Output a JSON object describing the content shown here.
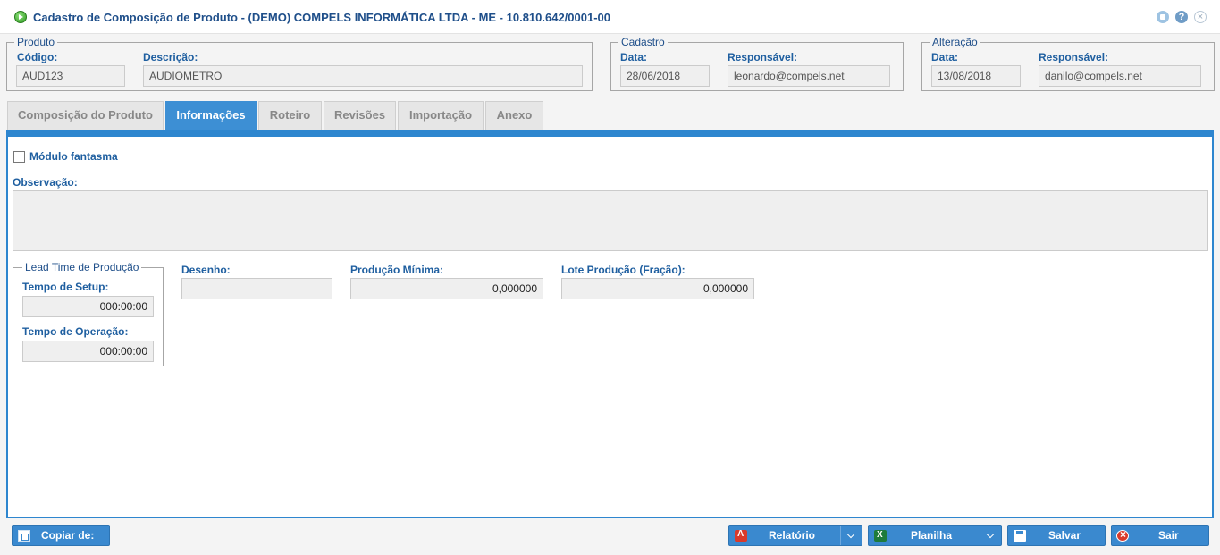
{
  "window": {
    "title": "Cadastro de Composição de Produto - (DEMO) COMPELS INFORMÁTICA LTDA - ME - 10.810.642/0001-00",
    "help_glyph": "?",
    "close_glyph": "×"
  },
  "produto": {
    "legend": "Produto",
    "codigo_label": "Código:",
    "codigo_value": "AUD123",
    "descricao_label": "Descrição:",
    "descricao_value": "AUDIOMETRO"
  },
  "cadastro": {
    "legend": "Cadastro",
    "data_label": "Data:",
    "data_value": "28/06/2018",
    "responsavel_label": "Responsável:",
    "responsavel_value": "leonardo@compels.net"
  },
  "alteracao": {
    "legend": "Alteração",
    "data_label": "Data:",
    "data_value": "13/08/2018",
    "responsavel_label": "Responsável:",
    "responsavel_value": "danilo@compels.net"
  },
  "tabs": [
    {
      "label": "Composição do Produto",
      "active": false
    },
    {
      "label": "Informações",
      "active": true
    },
    {
      "label": "Roteiro",
      "active": false
    },
    {
      "label": "Revisões",
      "active": false
    },
    {
      "label": "Importação",
      "active": false
    },
    {
      "label": "Anexo",
      "active": false
    }
  ],
  "informacoes": {
    "modulo_fantasma_label": "Módulo fantasma",
    "modulo_fantasma_checked": false,
    "observacao_label": "Observação:",
    "observacao_value": "",
    "lead_time": {
      "legend": "Lead Time de Produção",
      "setup_label": "Tempo de Setup:",
      "setup_value": "000:00:00",
      "operacao_label": "Tempo de Operação:",
      "operacao_value": "000:00:00"
    },
    "desenho_label": "Desenho:",
    "desenho_value": "",
    "producao_minima_label": "Produção Mínima:",
    "producao_minima_value": "0,000000",
    "lote_producao_label": "Lote Produção (Fração):",
    "lote_producao_value": "0,000000"
  },
  "footer": {
    "copiar_label": "Copiar de:",
    "relatorio_label": "Relatório",
    "planilha_label": "Planilha",
    "salvar_label": "Salvar",
    "sair_label": "Sair"
  },
  "colors": {
    "accent": "#2e86cf",
    "label_blue": "#1f5fa0",
    "button_blue": "#3a89cf"
  }
}
